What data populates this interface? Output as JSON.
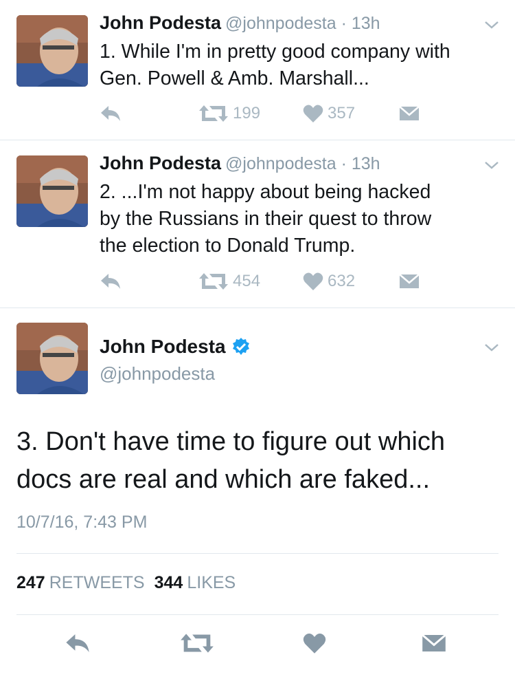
{
  "tweets": [
    {
      "author_name": "John Podesta",
      "handle": "@johnpodesta",
      "time": "13h",
      "lines": [
        "1. While I'm in pretty good company with",
        "Gen. Powell & Amb. Marshall..."
      ],
      "retweets": "199",
      "likes": "357"
    },
    {
      "author_name": "John Podesta",
      "handle": "@johnpodesta",
      "time": "13h",
      "lines": [
        "2. ...I'm not happy about being hacked",
        "by the Russians in their quest to throw",
        "the election to Donald Trump."
      ],
      "retweets": "454",
      "likes": "632"
    }
  ],
  "main_tweet": {
    "author_name": "John Podesta",
    "handle": "@johnpodesta",
    "lines": [
      "3. Don't have time to figure out which",
      "docs are real and which are faked..."
    ],
    "timestamp": "10/7/16, 7:43 PM",
    "retweet_count": "247",
    "retweet_label": "RETWEETS",
    "like_count": "344",
    "like_label": "LIKES"
  },
  "icons": {
    "reply": "reply-icon",
    "retweet": "retweet-icon",
    "like": "heart-icon",
    "dm": "envelope-icon",
    "more": "chevron-down-icon",
    "verified": "verified-badge-icon"
  },
  "colors": {
    "text": "#14171a",
    "muted": "#8899a6",
    "action": "#aab8c2",
    "verified": "#1da1f2",
    "divider": "#e1e8ed"
  }
}
